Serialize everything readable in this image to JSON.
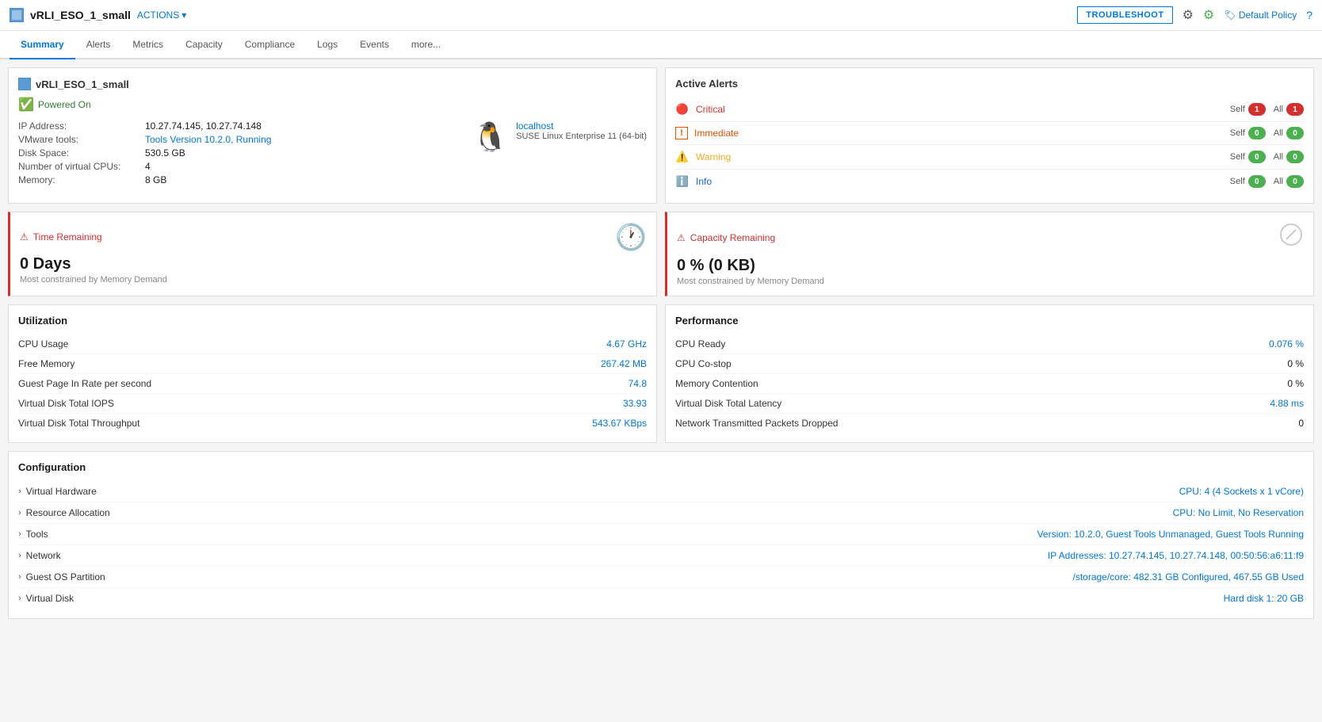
{
  "header": {
    "vm_icon_label": "VM",
    "title": "vRLI_ESO_1_small",
    "actions_label": "ACTIONS",
    "troubleshoot_label": "TROUBLESHOOT",
    "policy_icon": "🏷",
    "policy_label": "Default Policy",
    "help_icon": "?"
  },
  "nav": {
    "tabs": [
      {
        "id": "summary",
        "label": "Summary",
        "active": true
      },
      {
        "id": "alerts",
        "label": "Alerts",
        "active": false
      },
      {
        "id": "metrics",
        "label": "Metrics",
        "active": false
      },
      {
        "id": "capacity",
        "label": "Capacity",
        "active": false
      },
      {
        "id": "compliance",
        "label": "Compliance",
        "active": false
      },
      {
        "id": "logs",
        "label": "Logs",
        "active": false
      },
      {
        "id": "events",
        "label": "Events",
        "active": false
      },
      {
        "id": "more",
        "label": "more...",
        "active": false
      }
    ]
  },
  "vm_info": {
    "name": "vRLI_ESO_1_small",
    "status": "Powered On",
    "hostname": "localhost",
    "os": "SUSE Linux Enterprise 11 (64-bit)",
    "ip_label": "IP Address:",
    "ip_value": "10.27.74.145, 10.27.74.148",
    "vmware_tools_label": "VMware tools:",
    "vmware_tools_value": "Tools Version 10.2.0, Running",
    "disk_space_label": "Disk Space:",
    "disk_space_value": "530.5 GB",
    "cpu_label": "Number of virtual CPUs:",
    "cpu_value": "4",
    "memory_label": "Memory:",
    "memory_value": "8 GB"
  },
  "active_alerts": {
    "title": "Active Alerts",
    "alerts": [
      {
        "id": "critical",
        "icon": "⊘",
        "name": "Critical",
        "self_label": "Self",
        "self_count": "1",
        "self_badge": "red",
        "all_label": "All",
        "all_count": "1",
        "all_badge": "red"
      },
      {
        "id": "immediate",
        "icon": "!",
        "name": "Immediate",
        "self_label": "Self",
        "self_count": "0",
        "self_badge": "green",
        "all_label": "All",
        "all_count": "0",
        "all_badge": "green"
      },
      {
        "id": "warning",
        "icon": "⚠",
        "name": "Warning",
        "self_label": "Self",
        "self_count": "0",
        "self_badge": "green",
        "all_label": "All",
        "all_count": "0",
        "all_badge": "green"
      },
      {
        "id": "info",
        "icon": "ℹ",
        "name": "Info",
        "self_label": "Self",
        "self_count": "0",
        "self_badge": "green",
        "all_label": "All",
        "all_count": "0",
        "all_badge": "green"
      }
    ]
  },
  "time_remaining": {
    "title": "Time Remaining",
    "value": "0 Days",
    "subtitle": "Most constrained by Memory Demand",
    "icon": "🕐"
  },
  "capacity_remaining": {
    "title": "Capacity Remaining",
    "value": "0 % (0 KB)",
    "subtitle": "Most constrained by Memory Demand",
    "icon": "⊘"
  },
  "utilization": {
    "title": "Utilization",
    "metrics": [
      {
        "label": "CPU Usage",
        "value": "4.67 GHz",
        "colored": true
      },
      {
        "label": "Free Memory",
        "value": "267.42 MB",
        "colored": true
      },
      {
        "label": "Guest Page In Rate per second",
        "value": "74.8",
        "colored": true
      },
      {
        "label": "Virtual Disk Total IOPS",
        "value": "33.93",
        "colored": true
      },
      {
        "label": "Virtual Disk Total Throughput",
        "value": "543.67 KBps",
        "colored": true
      }
    ]
  },
  "performance": {
    "title": "Performance",
    "metrics": [
      {
        "label": "CPU Ready",
        "value": "0.076 %",
        "colored": true
      },
      {
        "label": "CPU Co-stop",
        "value": "0 %",
        "colored": false
      },
      {
        "label": "Memory Contention",
        "value": "0 %",
        "colored": false
      },
      {
        "label": "Virtual Disk Total Latency",
        "value": "4.88 ms",
        "colored": true
      },
      {
        "label": "Network Transmitted Packets Dropped",
        "value": "0",
        "colored": false
      }
    ]
  },
  "configuration": {
    "title": "Configuration",
    "items": [
      {
        "label": "Virtual Hardware",
        "value": "CPU: 4 (4 Sockets x 1 vCore)"
      },
      {
        "label": "Resource Allocation",
        "value": "CPU: No Limit, No Reservation"
      },
      {
        "label": "Tools",
        "value": "Version: 10.2.0, Guest Tools Unmanaged, Guest Tools Running"
      },
      {
        "label": "Network",
        "value": "IP Addresses: 10.27.74.145, 10.27.74.148, 00:50:56:a6:11:f9"
      },
      {
        "label": "Guest OS Partition",
        "value": "/storage/core: 482.31 GB Configured, 467.55 GB Used"
      },
      {
        "label": "Virtual Disk",
        "value": "Hard disk 1: 20 GB"
      }
    ]
  }
}
